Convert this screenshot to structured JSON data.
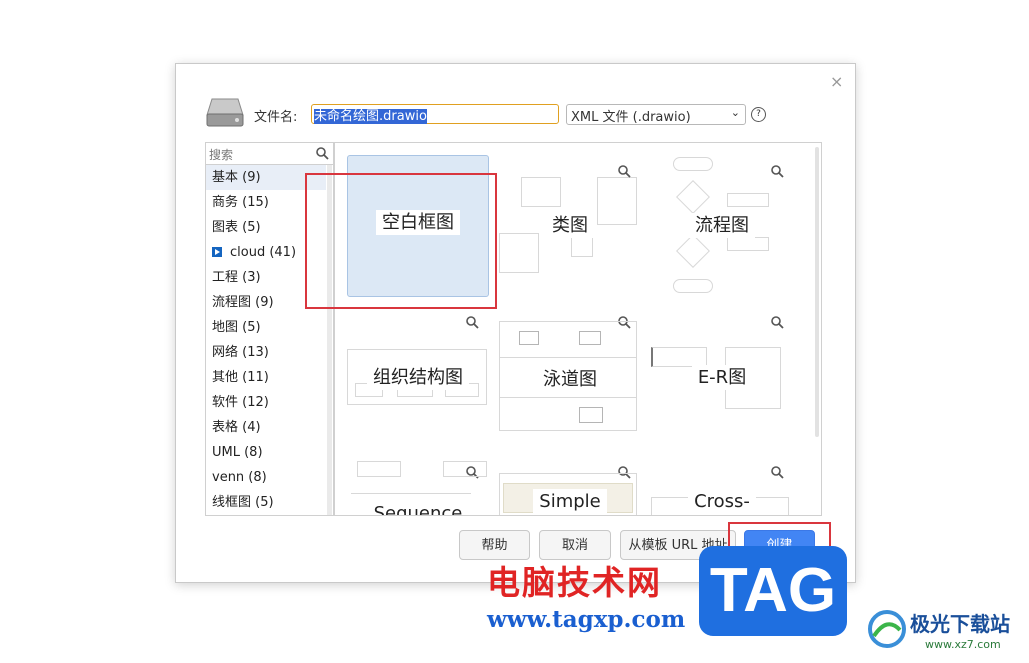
{
  "dialog": {
    "close_label": "×",
    "filename_label": "文件名:",
    "filename_value": "未命名绘图.drawio",
    "filetype_value": "XML 文件 (.drawio)",
    "help_label": "?"
  },
  "sidebar": {
    "search_placeholder": "搜索",
    "categories": [
      {
        "label": "基本 (9)"
      },
      {
        "label": "商务 (15)"
      },
      {
        "label": "图表 (5)"
      },
      {
        "label": "cloud (41)"
      },
      {
        "label": "工程 (3)"
      },
      {
        "label": "流程图 (9)"
      },
      {
        "label": "地图 (5)"
      },
      {
        "label": "网络 (13)"
      },
      {
        "label": "其他 (11)"
      },
      {
        "label": "软件 (12)"
      },
      {
        "label": "表格 (4)"
      },
      {
        "label": "UML (8)"
      },
      {
        "label": "venn (8)"
      },
      {
        "label": "线框图 (5)"
      }
    ]
  },
  "templates": [
    {
      "label": "空白框图"
    },
    {
      "label": "类图"
    },
    {
      "label": "流程图"
    },
    {
      "label": "组织结构图"
    },
    {
      "label": "泳道图"
    },
    {
      "label": "E-R图"
    },
    {
      "label": "Sequence"
    },
    {
      "label": "Simple"
    },
    {
      "label": "Cross-"
    }
  ],
  "buttons": {
    "help": "帮助",
    "cancel": "取消",
    "from_url": "从模板 URL 地址",
    "create": "创建"
  },
  "watermark": {
    "cn_text": "电脑技术网",
    "url_text": "www.tagxp.com",
    "tag_text": "TAG",
    "site_text": "极光下载站",
    "site_url": "www.xz7.com"
  },
  "colors": {
    "accent": "#4285f4",
    "highlight": "#d9363e",
    "selected_bg": "#dce8f5"
  }
}
